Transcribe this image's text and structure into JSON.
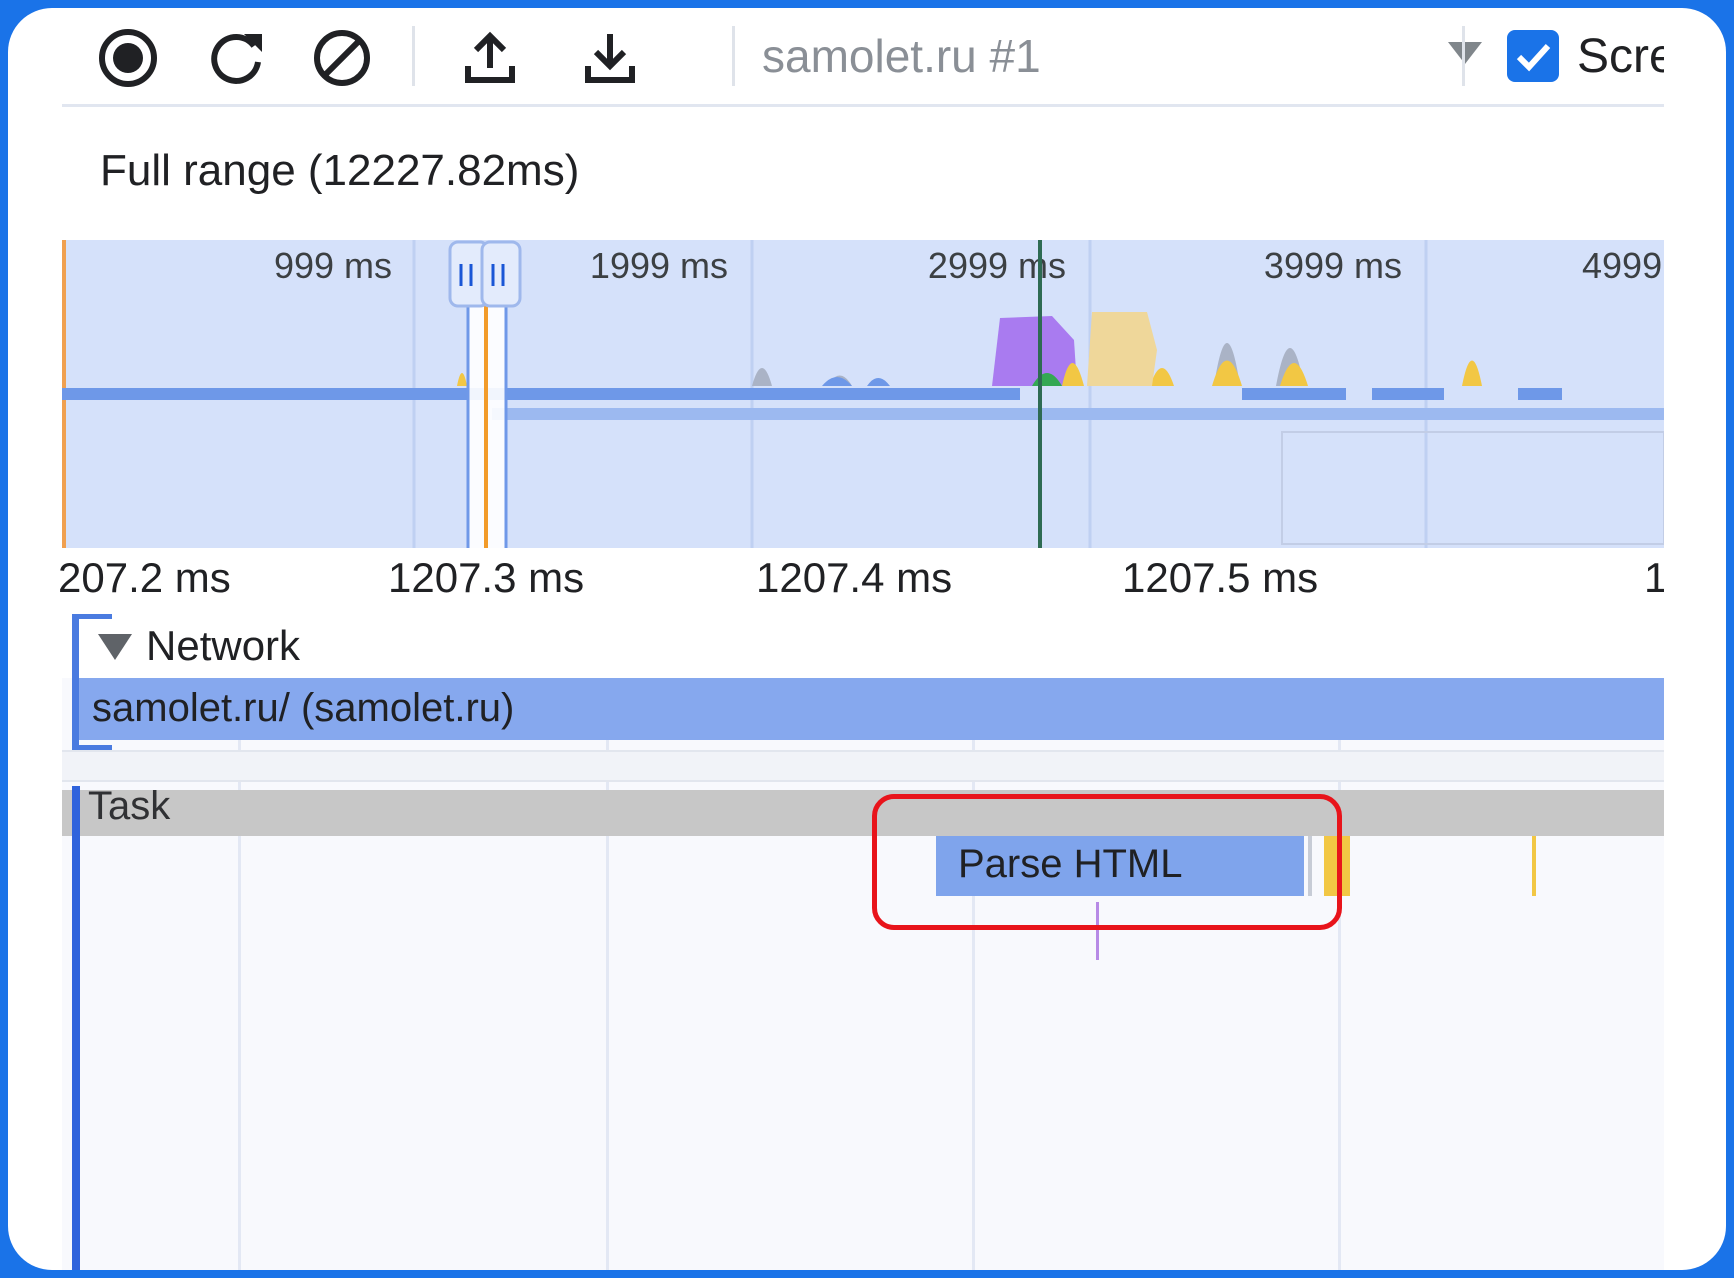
{
  "toolbar": {
    "record_icon": "record-icon",
    "reload_icon": "reload-icon",
    "clear_icon": "clear-icon",
    "upload_icon": "upload-icon",
    "download_icon": "download-icon",
    "profile_name": "samolet.ru #1",
    "screenshots_label": "Scre",
    "screenshots_checked": true
  },
  "range": {
    "label": "Full range (12227.82ms)"
  },
  "overview": {
    "tick_labels": [
      "999 ms",
      "1999 ms",
      "2999 ms",
      "3999 ms",
      "4999"
    ]
  },
  "ruler": {
    "tick_labels": [
      "207.2 ms",
      "1207.3 ms",
      "1207.4 ms",
      "1207.5 ms",
      "1"
    ]
  },
  "network": {
    "title": "Network",
    "request_label": "samolet.ru/ (samolet.ru)"
  },
  "main": {
    "task_label": "Task",
    "event_label": "Parse HTML"
  },
  "colors": {
    "accent": "#1a73e8",
    "highlight": "#e8141b",
    "network_bar": "#86a8ee",
    "parse_html": "#7fa4ec",
    "scripting": "#f2c744",
    "rendering": "#a97bf0"
  }
}
